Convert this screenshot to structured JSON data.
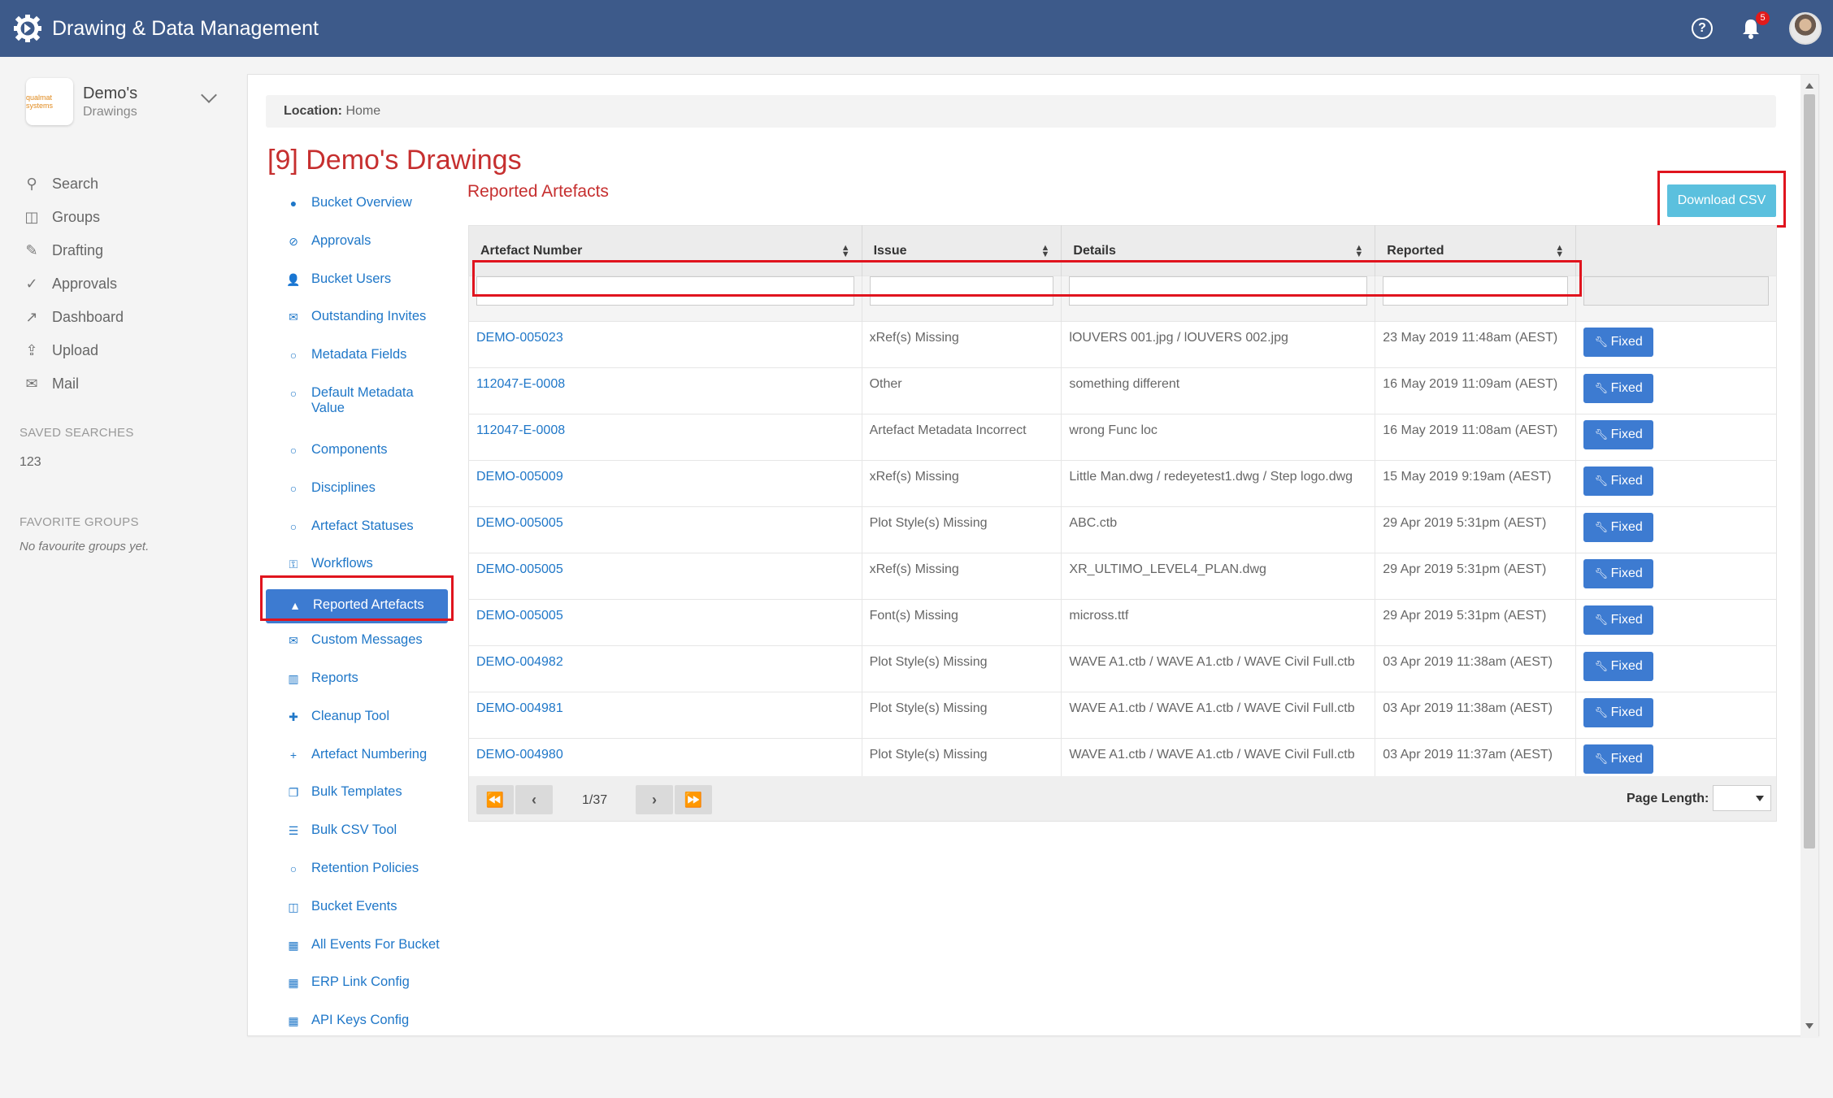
{
  "app": {
    "title": "Drawing & Data Management",
    "notification_count": "5"
  },
  "brand": {
    "name": "Demo's",
    "sub": "Drawings",
    "logo_text": "qualmat systems"
  },
  "sidebar": {
    "items": [
      {
        "label": "Search",
        "icon": "search-icon"
      },
      {
        "label": "Groups",
        "icon": "groups-icon"
      },
      {
        "label": "Drafting",
        "icon": "pencil-icon"
      },
      {
        "label": "Approvals",
        "icon": "check-icon"
      },
      {
        "label": "Dashboard",
        "icon": "trend-icon"
      },
      {
        "label": "Upload",
        "icon": "upload-icon"
      },
      {
        "label": "Mail",
        "icon": "mail-icon"
      }
    ],
    "saved_searches_heading": "SAVED SEARCHES",
    "saved_search": "123",
    "favorite_groups_heading": "FAVORITE GROUPS",
    "favorite_groups_empty": "No favourite groups yet."
  },
  "location": {
    "label": "Location:",
    "value": "Home"
  },
  "page": {
    "title": "[9] Demo's Drawings",
    "section": "Reported Artefacts",
    "download_csv": "Download CSV"
  },
  "subnav": [
    {
      "label": "Bucket Overview",
      "icon": "info-icon"
    },
    {
      "label": "Approvals",
      "icon": "check-circle-icon"
    },
    {
      "label": "Bucket Users",
      "icon": "user-icon"
    },
    {
      "label": "Outstanding Invites",
      "icon": "envelope-icon"
    },
    {
      "label": "Metadata Fields",
      "icon": "circle-icon"
    },
    {
      "label": "Default Metadata Value",
      "icon": "circle-icon"
    },
    {
      "label": "Components",
      "icon": "circle-icon"
    },
    {
      "label": "Disciplines",
      "icon": "circle-icon"
    },
    {
      "label": "Artefact Statuses",
      "icon": "circle-icon"
    },
    {
      "label": "Workflows",
      "icon": "sitemap-icon"
    },
    {
      "label": "Reported Artefacts",
      "icon": "warning-icon",
      "active": true
    },
    {
      "label": "Custom Messages",
      "icon": "envelope-open-icon"
    },
    {
      "label": "Reports",
      "icon": "bar-chart-icon"
    },
    {
      "label": "Cleanup Tool",
      "icon": "puzzle-icon"
    },
    {
      "label": "Artefact Numbering",
      "icon": "plus-icon"
    },
    {
      "label": "Bulk Templates",
      "icon": "copy-icon"
    },
    {
      "label": "Bulk CSV Tool",
      "icon": "list-icon"
    },
    {
      "label": "Retention Policies",
      "icon": "circle-icon"
    },
    {
      "label": "Bucket Events",
      "icon": "columns-icon"
    },
    {
      "label": "All Events For Bucket",
      "icon": "table-icon"
    },
    {
      "label": "ERP Link Config",
      "icon": "table-icon"
    },
    {
      "label": "API Keys Config",
      "icon": "table-icon"
    }
  ],
  "table": {
    "columns": [
      "Artefact Number",
      "Issue",
      "Details",
      "Reported"
    ],
    "fixed_label": "Fixed",
    "rows": [
      [
        "DEMO-005023",
        "xRef(s) Missing",
        "lOUVERS 001.jpg / lOUVERS 002.jpg",
        "23 May 2019 11:48am (AEST)"
      ],
      [
        "112047-E-0008",
        "Other",
        "something different",
        "16 May 2019 11:09am (AEST)"
      ],
      [
        "112047-E-0008",
        "Artefact Metadata Incorrect",
        "wrong Func loc",
        "16 May 2019 11:08am (AEST)"
      ],
      [
        "DEMO-005009",
        "xRef(s) Missing",
        "Little Man.dwg / redeyetest1.dwg / Step logo.dwg",
        "15 May 2019 9:19am (AEST)"
      ],
      [
        "DEMO-005005",
        "Plot Style(s) Missing",
        "ABC.ctb",
        "29 Apr 2019 5:31pm (AEST)"
      ],
      [
        "DEMO-005005",
        "xRef(s) Missing",
        "XR_ULTIMO_LEVEL4_PLAN.dwg",
        "29 Apr 2019 5:31pm (AEST)"
      ],
      [
        "DEMO-005005",
        "Font(s) Missing",
        "micross.ttf",
        "29 Apr 2019 5:31pm (AEST)"
      ],
      [
        "DEMO-004982",
        "Plot Style(s) Missing",
        "WAVE A1.ctb / WAVE A1.ctb / WAVE Civil Full.ctb",
        "03 Apr 2019 11:38am (AEST)"
      ],
      [
        "DEMO-004981",
        "Plot Style(s) Missing",
        "WAVE A1.ctb / WAVE A1.ctb / WAVE Civil Full.ctb",
        "03 Apr 2019 11:38am (AEST)"
      ],
      [
        "DEMO-004980",
        "Plot Style(s) Missing",
        "WAVE A1.ctb / WAVE A1.ctb / WAVE Civil Full.ctb",
        "03 Apr 2019 11:37am (AEST)"
      ]
    ]
  },
  "pager": {
    "page": "1/37",
    "page_length_label": "Page Length:"
  }
}
